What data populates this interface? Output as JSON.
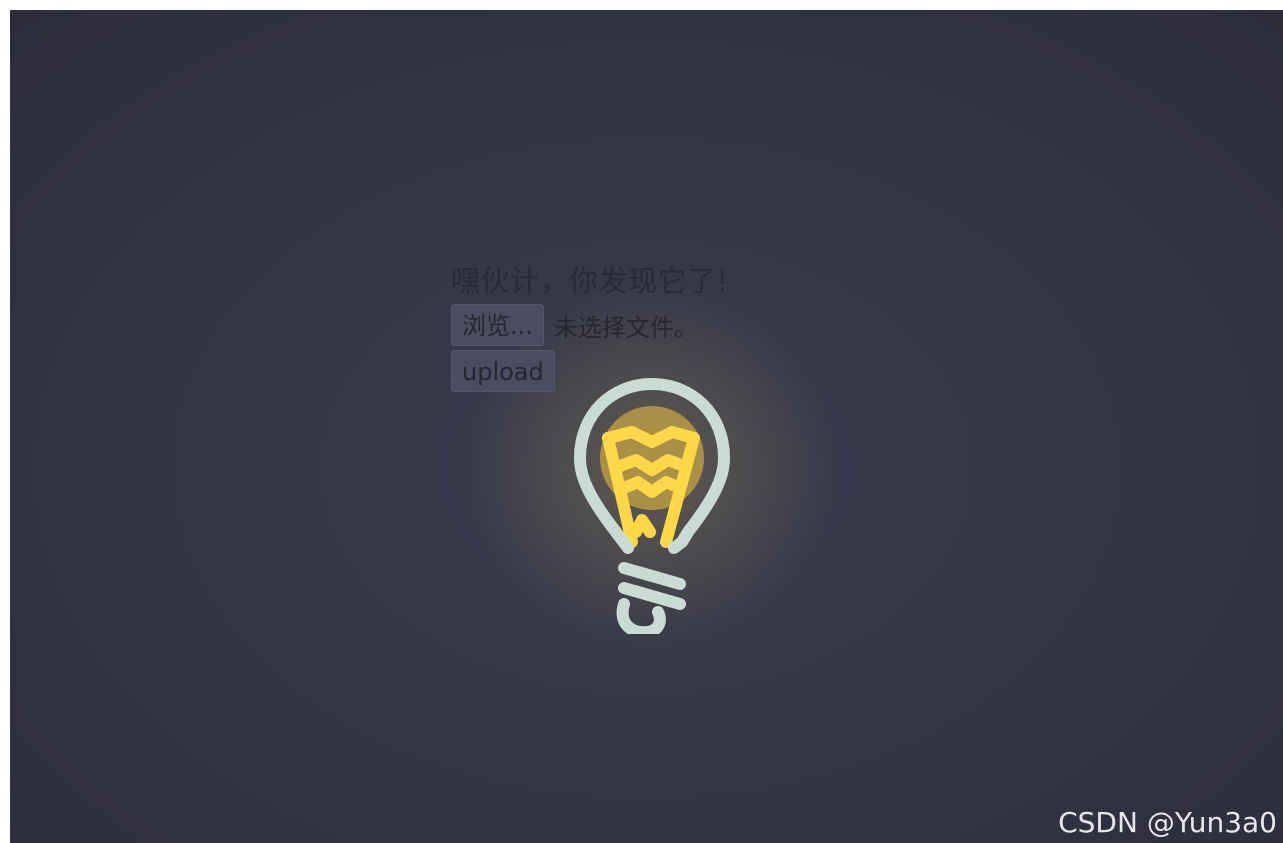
{
  "page": {
    "hint_text": "嘿伙计，你发现它了!",
    "file_input": {
      "browse_label": "浏览...",
      "status_text": "未选择文件。"
    },
    "upload_label": "upload",
    "watermark": "CSDN @Yun3a0"
  },
  "icons": {
    "bulb": "lightbulb-icon"
  },
  "colors": {
    "background": "#343646",
    "bulb_outline": "#c9dcd4",
    "filament": "#ffd84a",
    "glow": "#b99a45"
  }
}
